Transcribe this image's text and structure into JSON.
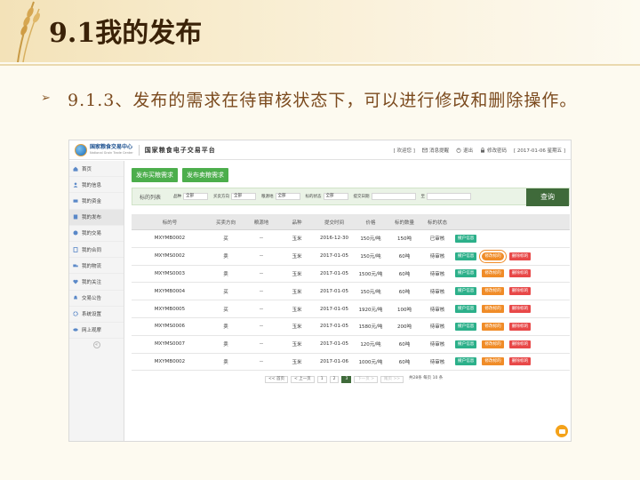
{
  "slide": {
    "title": "9.1我的发布",
    "bullet": "9.1.3、发布的需求在待审核状态下，可以进行修改和删除操作。"
  },
  "header": {
    "logo_cn": "国家粮食交易中心",
    "logo_en": "National Grain Trade Center",
    "platform": "国家粮食电子交易平台",
    "welcome": "[ 欢迎您 ]",
    "messages": "消息提醒",
    "logout": "退出",
    "change_password": "修改密码",
    "date": "[ 2017-01-06 星期五 ]"
  },
  "sidebar": {
    "items": [
      {
        "label": "首页",
        "icon": "home-icon"
      },
      {
        "label": "我的信息",
        "icon": "user-icon"
      },
      {
        "label": "我的资金",
        "icon": "money-icon"
      },
      {
        "label": "我的发布",
        "icon": "publish-icon"
      },
      {
        "label": "我的交易",
        "icon": "trade-icon"
      },
      {
        "label": "我的合同",
        "icon": "contract-icon"
      },
      {
        "label": "我的物流",
        "icon": "truck-icon"
      },
      {
        "label": "我的关注",
        "icon": "heart-icon"
      },
      {
        "label": "交易公告",
        "icon": "bell-icon"
      },
      {
        "label": "系统设置",
        "icon": "gear-icon"
      },
      {
        "label": "网上观摩",
        "icon": "eye-icon"
      }
    ],
    "collapse": "«"
  },
  "actions": {
    "publish_buy": "发布买粮需求",
    "publish_sell": "发布卖粮需求"
  },
  "filter": {
    "title": "标的列表",
    "variety_label": "品种",
    "variety_value": "全部",
    "direction_label": "买卖方向",
    "direction_value": "全部",
    "origin_label": "粮源地",
    "origin_value": "全部",
    "status_label": "标的状态",
    "status_value": "全部",
    "date_label": "提交日期",
    "date_to": "至",
    "search": "查询"
  },
  "table": {
    "headers": [
      "标的号",
      "买卖方向",
      "粮源地",
      "品种",
      "提交时间",
      "价格",
      "标的数量",
      "标的状态"
    ],
    "rows": [
      {
        "id": "MXYMB0002",
        "dir": "买",
        "origin": "--",
        "variety": "玉米",
        "time": "2016-12-30",
        "price": "150元/吨",
        "qty": "150吨",
        "status": "已审核",
        "ops": [
          "撤户信息"
        ]
      },
      {
        "id": "MXYMS0002",
        "dir": "卖",
        "origin": "--",
        "variety": "玉米",
        "time": "2017-01-05",
        "price": "150元/吨",
        "qty": "60吨",
        "status": "待审核",
        "ops": [
          "撤户信息",
          "修改标的",
          "删除标的"
        ]
      },
      {
        "id": "MXYMS0003",
        "dir": "卖",
        "origin": "--",
        "variety": "玉米",
        "time": "2017-01-05",
        "price": "1500元/吨",
        "qty": "60吨",
        "status": "待审核",
        "ops": [
          "撤户信息",
          "修改标的",
          "删除标的"
        ]
      },
      {
        "id": "MXYMB0004",
        "dir": "买",
        "origin": "--",
        "variety": "玉米",
        "time": "2017-01-05",
        "price": "150元/吨",
        "qty": "60吨",
        "status": "待审核",
        "ops": [
          "撤户信息",
          "修改标的",
          "删除标的"
        ]
      },
      {
        "id": "MXYMB0005",
        "dir": "买",
        "origin": "--",
        "variety": "玉米",
        "time": "2017-01-05",
        "price": "1920元/吨",
        "qty": "100吨",
        "status": "待审核",
        "ops": [
          "撤户信息",
          "修改标的",
          "删除标的"
        ]
      },
      {
        "id": "MXYMS0006",
        "dir": "卖",
        "origin": "--",
        "variety": "玉米",
        "time": "2017-01-05",
        "price": "1580元/吨",
        "qty": "200吨",
        "status": "待审核",
        "ops": [
          "撤户信息",
          "修改标的",
          "删除标的"
        ]
      },
      {
        "id": "MXYMS0007",
        "dir": "卖",
        "origin": "--",
        "variety": "玉米",
        "time": "2017-01-05",
        "price": "120元/吨",
        "qty": "60吨",
        "status": "待审核",
        "ops": [
          "撤户信息",
          "修改标的",
          "删除标的"
        ]
      },
      {
        "id": "MXYMB0002",
        "dir": "卖",
        "origin": "--",
        "variety": "玉米",
        "time": "2017-01-06",
        "price": "1000元/吨",
        "qty": "60吨",
        "status": "待审核",
        "ops": [
          "撤户信息",
          "修改标的",
          "删除标的"
        ]
      }
    ]
  },
  "pager": {
    "first": "<< 首页",
    "prev": "< 上一页",
    "pages": [
      "1",
      "2",
      "3"
    ],
    "current": "3",
    "next": "下一页 >",
    "last": "尾页 >>",
    "summary": "共28条 每页 10 条"
  }
}
